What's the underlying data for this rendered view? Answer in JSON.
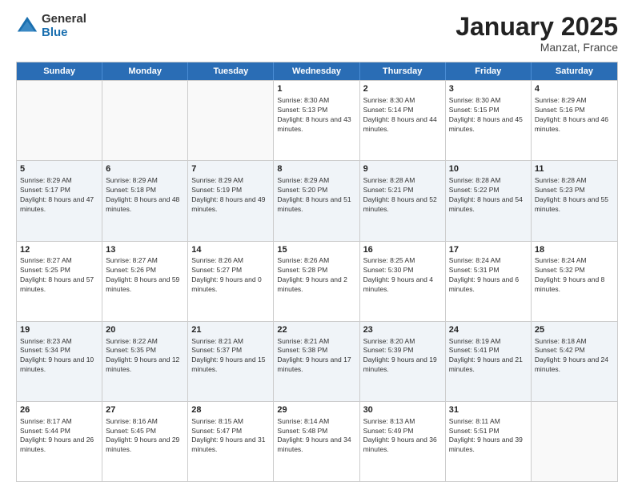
{
  "logo": {
    "general": "General",
    "blue": "Blue"
  },
  "header": {
    "month": "January 2025",
    "location": "Manzat, France"
  },
  "weekdays": [
    "Sunday",
    "Monday",
    "Tuesday",
    "Wednesday",
    "Thursday",
    "Friday",
    "Saturday"
  ],
  "rows": [
    [
      {
        "day": "",
        "empty": true
      },
      {
        "day": "",
        "empty": true
      },
      {
        "day": "",
        "empty": true
      },
      {
        "day": "1",
        "sunrise": "8:30 AM",
        "sunset": "5:13 PM",
        "daylight": "8 hours and 43 minutes."
      },
      {
        "day": "2",
        "sunrise": "8:30 AM",
        "sunset": "5:14 PM",
        "daylight": "8 hours and 44 minutes."
      },
      {
        "day": "3",
        "sunrise": "8:30 AM",
        "sunset": "5:15 PM",
        "daylight": "8 hours and 45 minutes."
      },
      {
        "day": "4",
        "sunrise": "8:29 AM",
        "sunset": "5:16 PM",
        "daylight": "8 hours and 46 minutes."
      }
    ],
    [
      {
        "day": "5",
        "sunrise": "8:29 AM",
        "sunset": "5:17 PM",
        "daylight": "8 hours and 47 minutes."
      },
      {
        "day": "6",
        "sunrise": "8:29 AM",
        "sunset": "5:18 PM",
        "daylight": "8 hours and 48 minutes."
      },
      {
        "day": "7",
        "sunrise": "8:29 AM",
        "sunset": "5:19 PM",
        "daylight": "8 hours and 49 minutes."
      },
      {
        "day": "8",
        "sunrise": "8:29 AM",
        "sunset": "5:20 PM",
        "daylight": "8 hours and 51 minutes."
      },
      {
        "day": "9",
        "sunrise": "8:28 AM",
        "sunset": "5:21 PM",
        "daylight": "8 hours and 52 minutes."
      },
      {
        "day": "10",
        "sunrise": "8:28 AM",
        "sunset": "5:22 PM",
        "daylight": "8 hours and 54 minutes."
      },
      {
        "day": "11",
        "sunrise": "8:28 AM",
        "sunset": "5:23 PM",
        "daylight": "8 hours and 55 minutes."
      }
    ],
    [
      {
        "day": "12",
        "sunrise": "8:27 AM",
        "sunset": "5:25 PM",
        "daylight": "8 hours and 57 minutes."
      },
      {
        "day": "13",
        "sunrise": "8:27 AM",
        "sunset": "5:26 PM",
        "daylight": "8 hours and 59 minutes."
      },
      {
        "day": "14",
        "sunrise": "8:26 AM",
        "sunset": "5:27 PM",
        "daylight": "9 hours and 0 minutes."
      },
      {
        "day": "15",
        "sunrise": "8:26 AM",
        "sunset": "5:28 PM",
        "daylight": "9 hours and 2 minutes."
      },
      {
        "day": "16",
        "sunrise": "8:25 AM",
        "sunset": "5:30 PM",
        "daylight": "9 hours and 4 minutes."
      },
      {
        "day": "17",
        "sunrise": "8:24 AM",
        "sunset": "5:31 PM",
        "daylight": "9 hours and 6 minutes."
      },
      {
        "day": "18",
        "sunrise": "8:24 AM",
        "sunset": "5:32 PM",
        "daylight": "9 hours and 8 minutes."
      }
    ],
    [
      {
        "day": "19",
        "sunrise": "8:23 AM",
        "sunset": "5:34 PM",
        "daylight": "9 hours and 10 minutes."
      },
      {
        "day": "20",
        "sunrise": "8:22 AM",
        "sunset": "5:35 PM",
        "daylight": "9 hours and 12 minutes."
      },
      {
        "day": "21",
        "sunrise": "8:21 AM",
        "sunset": "5:37 PM",
        "daylight": "9 hours and 15 minutes."
      },
      {
        "day": "22",
        "sunrise": "8:21 AM",
        "sunset": "5:38 PM",
        "daylight": "9 hours and 17 minutes."
      },
      {
        "day": "23",
        "sunrise": "8:20 AM",
        "sunset": "5:39 PM",
        "daylight": "9 hours and 19 minutes."
      },
      {
        "day": "24",
        "sunrise": "8:19 AM",
        "sunset": "5:41 PM",
        "daylight": "9 hours and 21 minutes."
      },
      {
        "day": "25",
        "sunrise": "8:18 AM",
        "sunset": "5:42 PM",
        "daylight": "9 hours and 24 minutes."
      }
    ],
    [
      {
        "day": "26",
        "sunrise": "8:17 AM",
        "sunset": "5:44 PM",
        "daylight": "9 hours and 26 minutes."
      },
      {
        "day": "27",
        "sunrise": "8:16 AM",
        "sunset": "5:45 PM",
        "daylight": "9 hours and 29 minutes."
      },
      {
        "day": "28",
        "sunrise": "8:15 AM",
        "sunset": "5:47 PM",
        "daylight": "9 hours and 31 minutes."
      },
      {
        "day": "29",
        "sunrise": "8:14 AM",
        "sunset": "5:48 PM",
        "daylight": "9 hours and 34 minutes."
      },
      {
        "day": "30",
        "sunrise": "8:13 AM",
        "sunset": "5:49 PM",
        "daylight": "9 hours and 36 minutes."
      },
      {
        "day": "31",
        "sunrise": "8:11 AM",
        "sunset": "5:51 PM",
        "daylight": "9 hours and 39 minutes."
      },
      {
        "day": "",
        "empty": true
      }
    ]
  ]
}
